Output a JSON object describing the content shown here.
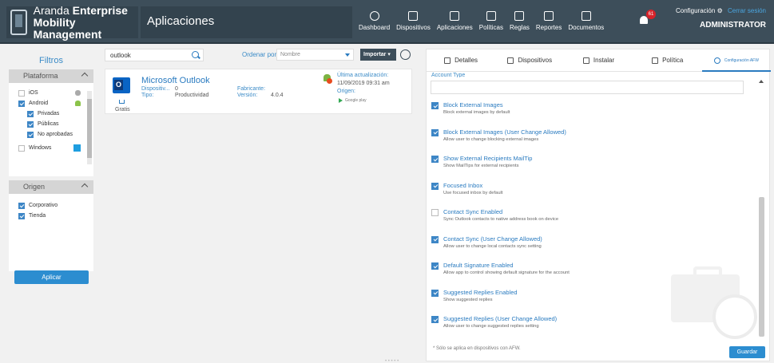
{
  "header": {
    "brand_line1": "Aranda",
    "brand_line1_bold": "Enterprise",
    "brand_line2": "Mobility Management",
    "app_title": "Aplicaciones",
    "nav": [
      {
        "label": "Dashboard",
        "icon": "dashboard-icon"
      },
      {
        "label": "Dispositivos",
        "icon": "devices-icon"
      },
      {
        "label": "Aplicaciones",
        "icon": "grid-icon"
      },
      {
        "label": "Políticas",
        "icon": "policy-icon"
      },
      {
        "label": "Reglas",
        "icon": "rules-icon"
      },
      {
        "label": "Reportes",
        "icon": "report-icon"
      },
      {
        "label": "Documentos",
        "icon": "document-icon"
      }
    ],
    "notifications_count": "61",
    "config_label": "Configuración",
    "logout_label": "Cerrar sesión",
    "user": "ADMINISTRATOR"
  },
  "filters": {
    "title": "Filtros",
    "platform": {
      "title": "Plataforma",
      "options": [
        {
          "label": "iOS",
          "checked": false
        },
        {
          "label": "Android",
          "checked": true
        },
        {
          "label": "Privadas",
          "checked": true
        },
        {
          "label": "Públicas",
          "checked": true
        },
        {
          "label": "No aprobadas",
          "checked": true
        },
        {
          "label": "Windows",
          "checked": false
        }
      ]
    },
    "origin": {
      "title": "Origen",
      "options": [
        {
          "label": "Corporativo",
          "checked": true
        },
        {
          "label": "Tienda",
          "checked": true
        }
      ]
    },
    "apply_label": "Aplicar"
  },
  "toolbar": {
    "search_value": "outlook",
    "sort_label": "Ordenar por:",
    "sort_value": "Nombre",
    "import_label": "Importar"
  },
  "app": {
    "name": "Microsoft Outlook",
    "devices_label": "Dispositiv...",
    "devices_value": "0",
    "type_label": "Tipo:",
    "type_value": "Productividad",
    "maker_label": "Fabricante:",
    "maker_value": "",
    "version_label": "Versión:",
    "version_value": "4.0.4",
    "update_label": "Última actualización:",
    "update_value": "11/09/2019 09:31 am",
    "origin_label": "Origen:",
    "store_label": "Google play",
    "price_label": "Gratis"
  },
  "detail": {
    "tabs": [
      {
        "label": "Detalles",
        "active": false
      },
      {
        "label": "Dispositivos",
        "active": false
      },
      {
        "label": "Instalar",
        "active": false
      },
      {
        "label": "Política",
        "active": false
      },
      {
        "label": "Configuración AFW",
        "active": true
      }
    ],
    "section_cut": "Account Type",
    "settings": [
      {
        "title": "Block External Images",
        "desc": "Block external images by default",
        "checked": true
      },
      {
        "title": "Block External Images (User Change Allowed)",
        "desc": "Allow user to change blocking external images",
        "checked": true
      },
      {
        "title": "Show External Recipients MailTip",
        "desc": "Show MailTips for external recipients",
        "checked": true
      },
      {
        "title": "Focused Inbox",
        "desc": "Use focused inbox by default",
        "checked": true
      },
      {
        "title": "Contact Sync Enabled",
        "desc": "Sync Outlook contacts to native address book on device",
        "checked": false
      },
      {
        "title": "Contact Sync (User Change Allowed)",
        "desc": "Allow user to change local contacts sync setting",
        "checked": true
      },
      {
        "title": "Default Signature Enabled",
        "desc": "Allow app to control showing default signature for the account",
        "checked": true
      },
      {
        "title": "Suggested Replies Enabled",
        "desc": "Show suggested replies",
        "checked": true
      },
      {
        "title": "Suggested Replies (User Change Allowed)",
        "desc": "Allow user to change suggested replies setting",
        "checked": true
      }
    ],
    "note": "* Sólo se aplica en dispositivos con AFW.",
    "save_label": "Guardar"
  },
  "colors": {
    "header_bg": "#3d4e5a",
    "accent": "#2a7bc0",
    "button": "#2c8dd0",
    "badge": "#d8232a"
  }
}
